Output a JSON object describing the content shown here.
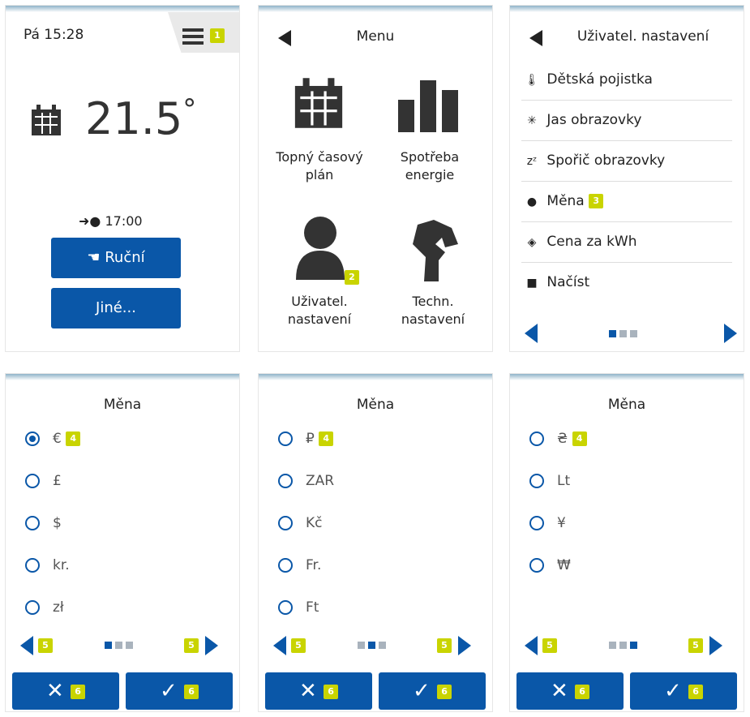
{
  "home": {
    "time": "Pá 15:28",
    "temperature": "21.5",
    "next_time": "17:00",
    "manual_label": "Ruční",
    "other_label": "Jiné...",
    "badge": "1"
  },
  "menu": {
    "title": "Menu",
    "items": [
      {
        "label": "Topný časový plán"
      },
      {
        "label": "Spotřeba energie"
      },
      {
        "label": "Uživatel. nastavení"
      },
      {
        "label": "Techn. nastavení"
      }
    ],
    "badge": "2"
  },
  "settings": {
    "title": "Uživatel. nastavení",
    "items": [
      {
        "label": "Dětská pojistka",
        "icon": "thermometer-icon"
      },
      {
        "label": "Jas obrazovky",
        "icon": "brightness-icon"
      },
      {
        "label": "Spořič obrazovky",
        "icon": "sleep-icon"
      },
      {
        "label": "Měna",
        "icon": "currency-icon"
      },
      {
        "label": "Cena za kWh",
        "icon": "tag-icon"
      },
      {
        "label": "Načíst",
        "icon": "document-icon"
      }
    ],
    "badge": "3"
  },
  "currency_pages": [
    {
      "title": "Měna",
      "options": [
        "€",
        "£",
        "$",
        "kr.",
        "zł"
      ],
      "selected": 0,
      "dots_active": 0
    },
    {
      "title": "Měna",
      "options": [
        "₽",
        "ZAR",
        "Kč",
        "Fr.",
        "Ft"
      ],
      "selected": -1,
      "dots_active": 1
    },
    {
      "title": "Měna",
      "options": [
        "₴",
        "Lt",
        "¥",
        "₩"
      ],
      "selected": -1,
      "dots_active": 2
    }
  ],
  "badges": {
    "list": "4",
    "nav": "5",
    "buttons": "6"
  }
}
